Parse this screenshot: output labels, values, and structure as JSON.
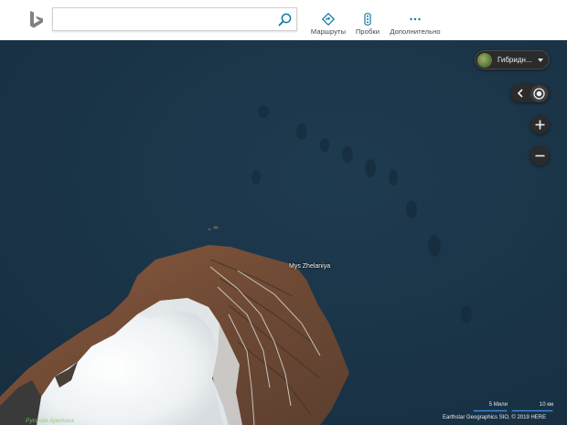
{
  "search": {
    "value": "",
    "placeholder": ""
  },
  "nav": [
    {
      "label": "Маршруты",
      "icon": "directions-icon"
    },
    {
      "label": "Пробки",
      "icon": "traffic-icon"
    },
    {
      "label": "Дополнительно",
      "icon": "more-icon"
    }
  ],
  "map": {
    "style_picker": {
      "label": "Гибридн..."
    },
    "place_label": "Mys Zhelaniya",
    "corner_label": "Русская Арктика",
    "scale": {
      "miles": "5 Мили",
      "km": "10 км"
    },
    "copyright": "Earthstar Geographics SIO, © 2019 HERE"
  },
  "colors": {
    "ocean": "#1b3548",
    "accent": "#0e7aa6",
    "scale_bar": "#3f8fd8"
  },
  "icons": [
    "bing-logo-icon",
    "search-icon",
    "map-style-thumbnail-icon",
    "chevron-down-icon",
    "chevron-left-icon",
    "locate-me-icon",
    "zoom-in-icon",
    "zoom-out-icon"
  ]
}
